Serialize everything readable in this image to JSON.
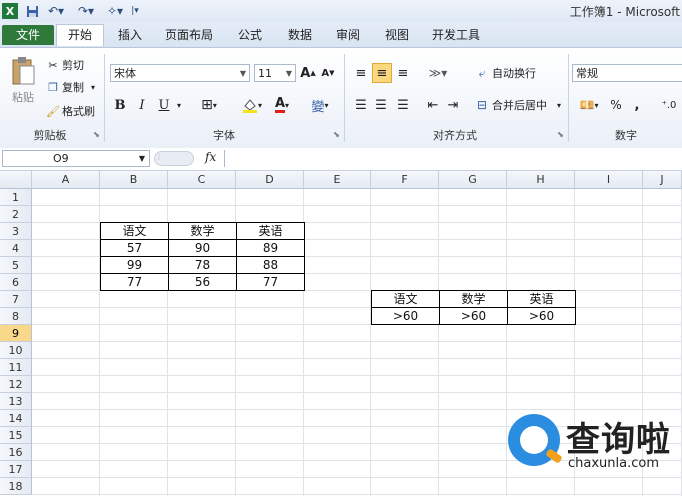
{
  "titlebar": {
    "title": "工作簿1 - Microsoft",
    "icons": [
      "excel-logo-icon",
      "save-icon",
      "undo-icon",
      "redo-icon",
      "customize-icon"
    ]
  },
  "tabs": [
    "文件",
    "开始",
    "插入",
    "页面布局",
    "公式",
    "数据",
    "审阅",
    "视图",
    "开发工具"
  ],
  "clipboard": {
    "paste": "粘贴",
    "cut": "剪切",
    "copy": "复制",
    "format_painter": "格式刷",
    "label": "剪贴板"
  },
  "font": {
    "name": "宋体",
    "size": "11",
    "bold": "B",
    "italic": "I",
    "underline": "U",
    "grow": "A",
    "shrink": "A",
    "font_color": "A",
    "label": "字体"
  },
  "alignment": {
    "wrap_text": "自动换行",
    "merge_center": "合并后居中",
    "label": "对齐方式"
  },
  "number": {
    "format": "常规",
    "percent": "%",
    "comma": ",",
    "label": "数字"
  },
  "formula_bar": {
    "cell_ref": "O9",
    "fx": "fx",
    "value": ""
  },
  "columns": [
    "A",
    "B",
    "C",
    "D",
    "E",
    "F",
    "G",
    "H",
    "I",
    "J"
  ],
  "rows": [
    "1",
    "2",
    "3",
    "4",
    "5",
    "6",
    "7",
    "8",
    "9",
    "10",
    "11",
    "12",
    "13",
    "14",
    "15",
    "16",
    "17",
    "18"
  ],
  "selected_row": "9",
  "data_table": [
    [
      "语文",
      "数学",
      "英语"
    ],
    [
      "57",
      "90",
      "89"
    ],
    [
      "99",
      "78",
      "88"
    ],
    [
      "77",
      "56",
      "77"
    ]
  ],
  "criteria_table": [
    [
      "语文",
      "数学",
      "英语"
    ],
    [
      ">60",
      ">60",
      ">60"
    ]
  ],
  "watermark": {
    "cn": "查询啦",
    "en": "chaxunla.com"
  }
}
